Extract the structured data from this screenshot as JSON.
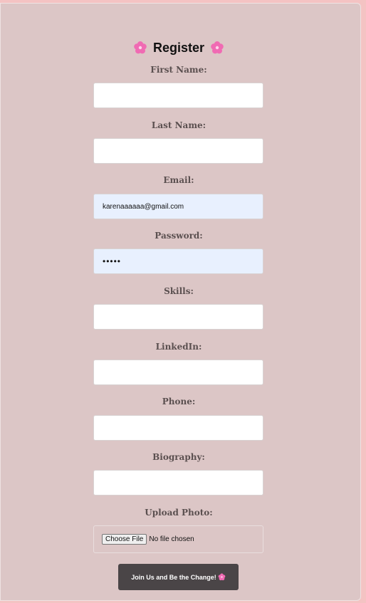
{
  "form": {
    "title": "Register",
    "title_icon": "flower-icon",
    "fields": {
      "first_name": {
        "label": "First Name:",
        "value": ""
      },
      "last_name": {
        "label": "Last Name:",
        "value": ""
      },
      "email": {
        "label": "Email:",
        "value": "karenaaaaaa@gmail.com"
      },
      "password": {
        "label": "Password:",
        "value": "•••••"
      },
      "skills": {
        "label": "Skills:",
        "value": ""
      },
      "linkedin": {
        "label": "LinkedIn:",
        "value": ""
      },
      "phone": {
        "label": "Phone:",
        "value": ""
      },
      "biography": {
        "label": "Biography:",
        "value": ""
      }
    },
    "upload": {
      "label": "Upload Photo:",
      "button_label": "Choose File",
      "status": "No file chosen"
    },
    "submit_label": "Join Us and Be the Change!"
  },
  "colors": {
    "page_background": "#f4c3c3",
    "card_background": "#dcc6c6",
    "autofill_background": "#e8f0fe",
    "button_background": "#4a4547",
    "flower": "#f06bb3"
  }
}
